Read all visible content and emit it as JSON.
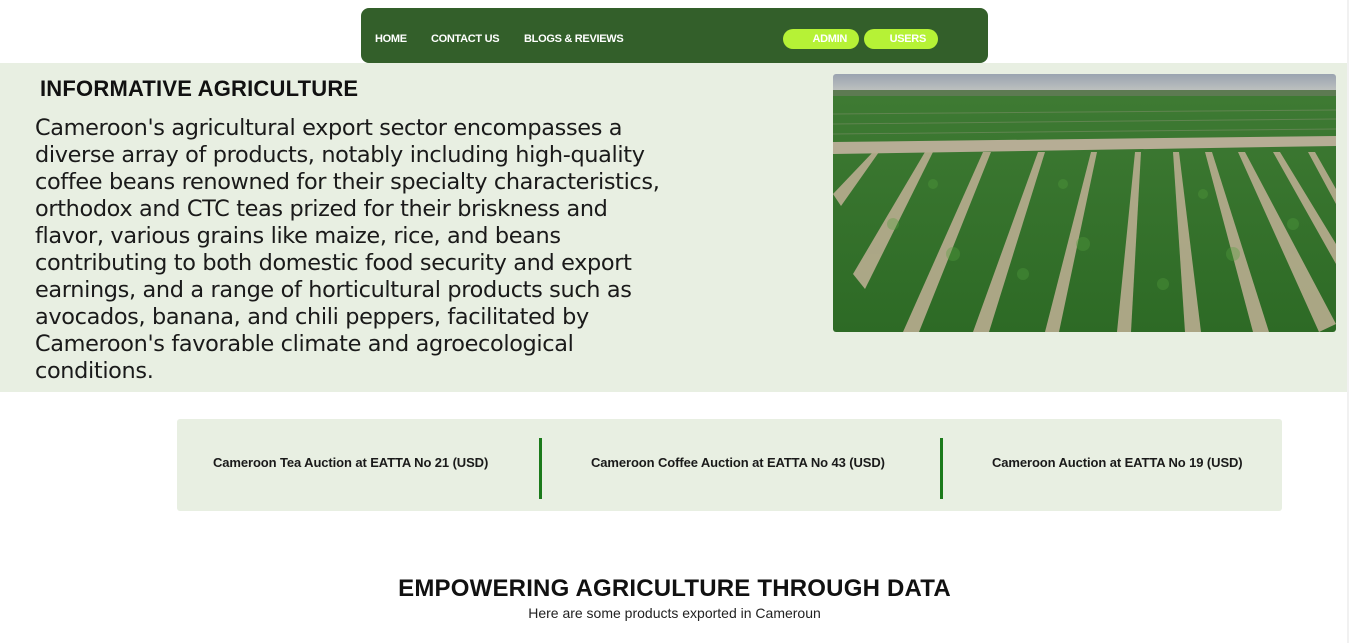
{
  "nav": {
    "home": "HOME",
    "contact": "CONTACT US",
    "blogs": "BLOGS & REVIEWS",
    "admin": "ADMIN",
    "users": "USERS"
  },
  "hero": {
    "title": "INFORMATIVE AGRICULTURE",
    "text": "Cameroon's agricultural export sector encompasses a diverse array of products, notably including high-quality coffee beans renowned for their specialty characteristics, orthodox and CTC teas prized for their briskness and flavor, various grains like maize, rice, and beans contributing to both domestic food security and export earnings, and a range of horticultural products such as avocados, banana, and chili peppers, facilitated by Cameroon's favorable climate and agroecological conditions."
  },
  "auctions": [
    {
      "label": "Cameroon Tea Auction at EATTA No 21 (USD)"
    },
    {
      "label": "Cameroon Coffee Auction at EATTA No 43 (USD)"
    },
    {
      "label": "Cameroon Auction at EATTA No 19 (USD)"
    }
  ],
  "section": {
    "title": "EMPOWERING AGRICULTURE THROUGH DATA",
    "subtitle": "Here are some products exported in Cameroun"
  },
  "colors": {
    "nav_bg": "#335f2a",
    "pill_bg": "#b6f236",
    "panel_bg": "#e8efe2",
    "divider": "#1b7a1b"
  }
}
